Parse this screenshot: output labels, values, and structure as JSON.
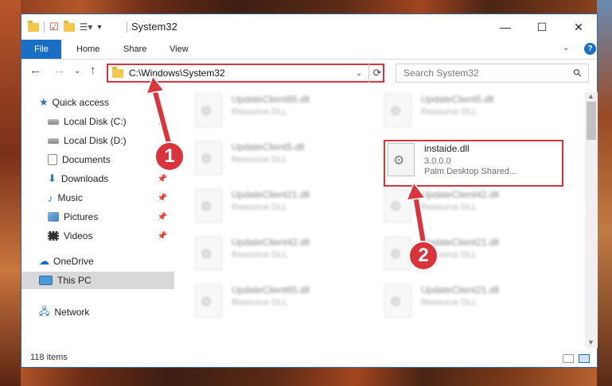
{
  "window": {
    "title": "System32"
  },
  "ribbon": {
    "file": "File",
    "tabs": [
      "Home",
      "Share",
      "View"
    ]
  },
  "address": {
    "path": "C:\\Windows\\System32"
  },
  "search": {
    "placeholder": "Search System32"
  },
  "sidebar": {
    "items": [
      {
        "label": "Quick access"
      },
      {
        "label": "Local Disk (C:)"
      },
      {
        "label": "Local Disk (D:)"
      },
      {
        "label": "Documents"
      },
      {
        "label": "Downloads"
      },
      {
        "label": "Music"
      },
      {
        "label": "Pictures"
      },
      {
        "label": "Videos"
      },
      {
        "label": "OneDrive"
      },
      {
        "label": "This PC"
      },
      {
        "label": "Network"
      }
    ]
  },
  "files": {
    "left": [
      {
        "name": "UpdateClient65.dll",
        "desc": "Resource DLL"
      },
      {
        "name": "UpdateClient5.dll",
        "desc": "Resource DLL"
      },
      {
        "name": "UpdateClient21.dll",
        "desc": "Resource DLL"
      },
      {
        "name": "UpdateClient42.dll",
        "desc": "Resource DLL"
      },
      {
        "name": "UpdateClient65.dll",
        "desc": "Resource DLL"
      }
    ],
    "right": [
      {
        "name": "UpdateClient5.dll",
        "desc": "Resource DLL"
      },
      {
        "name": "instaide.dll",
        "desc": "3.0.0.0",
        "desc2": "Palm Desktop Shared..."
      },
      {
        "name": "UpdateClient42.dll",
        "desc": "Resource DLL"
      },
      {
        "name": "UpdateClient21.dll",
        "desc": "Resource DLL"
      },
      {
        "name": "UpdateClient21.dll",
        "desc": "Resource DLL"
      }
    ]
  },
  "status": {
    "count": "118 items"
  },
  "callouts": {
    "one": "1",
    "two": "2"
  },
  "colors": {
    "accent": "#1a6fc4",
    "highlight": "#d9343b"
  }
}
